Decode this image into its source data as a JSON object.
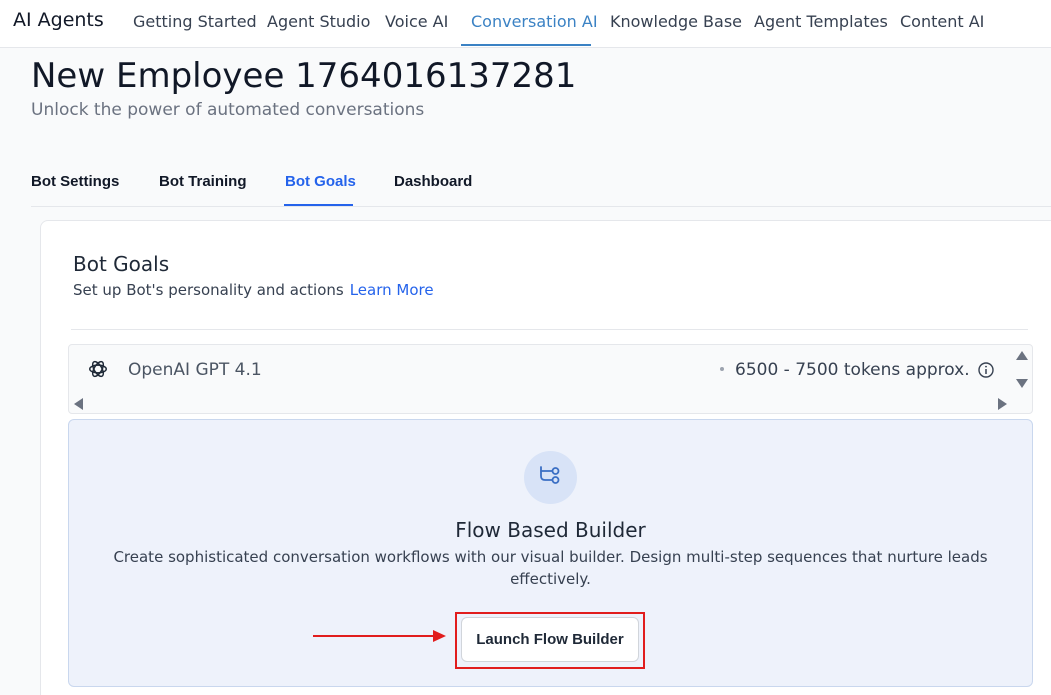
{
  "topnav": {
    "brand": "AI Agents",
    "tabs": [
      {
        "label": "Getting Started",
        "active": false
      },
      {
        "label": "Agent Studio",
        "active": false
      },
      {
        "label": "Voice AI",
        "active": false
      },
      {
        "label": "Conversation AI",
        "active": true
      },
      {
        "label": "Knowledge Base",
        "active": false
      },
      {
        "label": "Agent Templates",
        "active": false
      },
      {
        "label": "Content AI",
        "active": false
      }
    ]
  },
  "header": {
    "title": "New Employee 1764016137281",
    "subtitle": "Unlock the power of automated conversations"
  },
  "subtabs": [
    {
      "label": "Bot Settings",
      "active": false
    },
    {
      "label": "Bot Training",
      "active": false
    },
    {
      "label": "Bot Goals",
      "active": true
    },
    {
      "label": "Dashboard",
      "active": false
    }
  ],
  "bot_goals": {
    "title": "Bot Goals",
    "description": "Set up Bot's personality and actions",
    "learn_more": "Learn More"
  },
  "model": {
    "name": "OpenAI GPT 4.1",
    "tokens": "6500 - 7500 tokens approx.",
    "icon": "openai-icon"
  },
  "flow_builder": {
    "title": "Flow Based Builder",
    "description": "Create sophisticated conversation workflows with our visual builder. Design multi-step sequences that nurture leads effectively.",
    "button_label": "Launch Flow Builder",
    "icon": "flow-icon"
  },
  "colors": {
    "accent": "#2563eb",
    "nav_active": "#3b82c4",
    "highlight": "#e11d1d",
    "panel_bg": "#eef2fb"
  }
}
